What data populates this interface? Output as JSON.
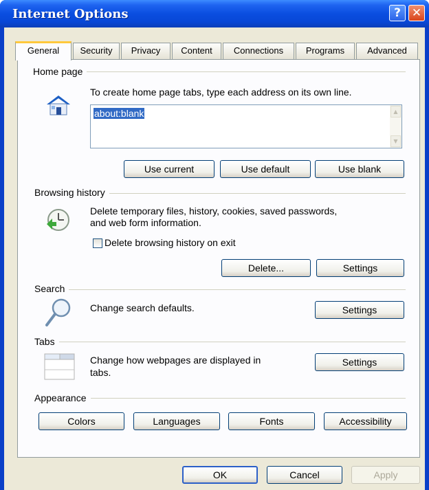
{
  "window": {
    "title": "Internet Options",
    "help_label": "?",
    "close_label": "✕"
  },
  "tabs": [
    "General",
    "Security",
    "Privacy",
    "Content",
    "Connections",
    "Programs",
    "Advanced"
  ],
  "home_page": {
    "section": "Home page",
    "instruction": "To create home page tabs, type each address on its own line.",
    "address": "about:blank",
    "use_current": "Use current",
    "use_default": "Use default",
    "use_blank": "Use blank",
    "icon": "home-icon"
  },
  "browsing_history": {
    "section": "Browsing history",
    "desc_line1": "Delete temporary files, history, cookies, saved passwords,",
    "desc_line2": "and web form information.",
    "checkbox_label": "Delete browsing history on exit",
    "checkbox_checked": false,
    "delete": "Delete...",
    "settings": "Settings",
    "icon": "history-clock-icon"
  },
  "search": {
    "section": "Search",
    "desc": "Change search defaults.",
    "settings": "Settings",
    "icon": "magnifier-icon"
  },
  "tabs_section": {
    "section": "Tabs",
    "desc_line1": "Change how webpages are displayed in",
    "desc_line2": "tabs.",
    "settings": "Settings",
    "icon": "tabs-window-icon"
  },
  "appearance": {
    "section": "Appearance",
    "colors": "Colors",
    "languages": "Languages",
    "fonts": "Fonts",
    "accessibility": "Accessibility"
  },
  "footer": {
    "ok": "OK",
    "cancel": "Cancel",
    "apply": "Apply"
  },
  "colors": {
    "title_bar": "#0a4ee0",
    "dialog_bg": "#ece9d8",
    "selection": "#316ac5",
    "close_button": "#d9441a"
  }
}
